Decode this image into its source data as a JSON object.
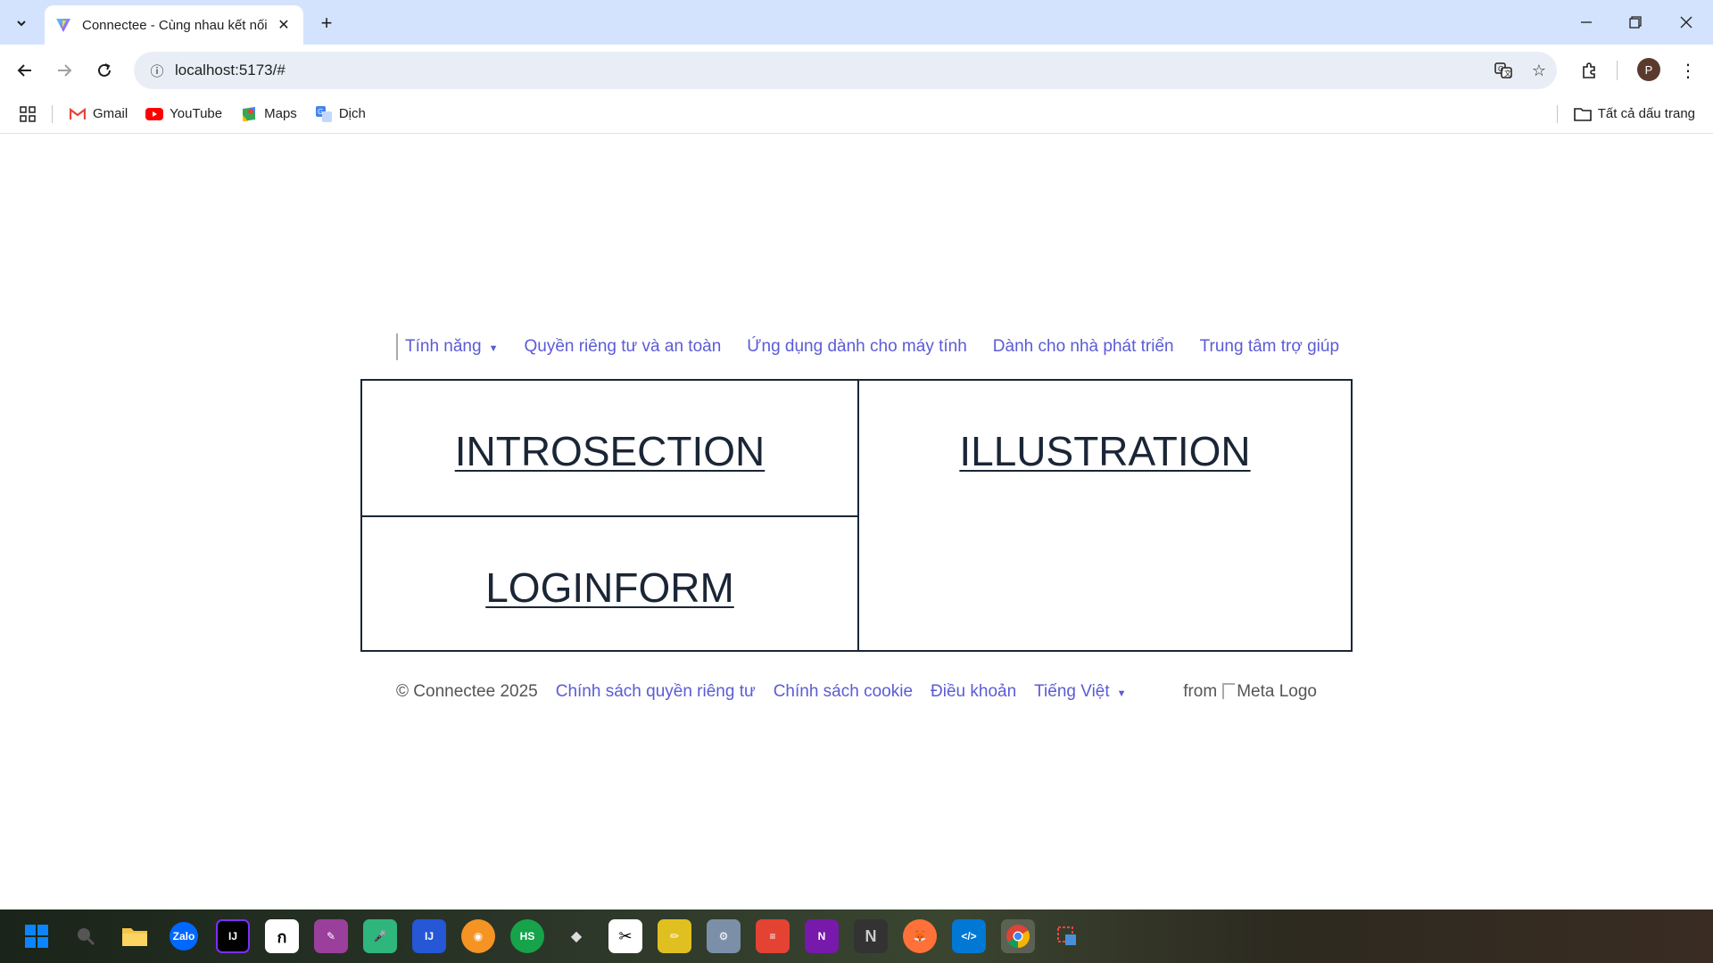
{
  "browser": {
    "tab_title": "Connectee - Cùng nhau kết nối",
    "url": "localhost:5173/#",
    "bookmarks": [
      {
        "label": "Gmail",
        "icon": "gmail-icon"
      },
      {
        "label": "YouTube",
        "icon": "youtube-icon"
      },
      {
        "label": "Maps",
        "icon": "maps-icon"
      },
      {
        "label": "Dịch",
        "icon": "translate-icon"
      }
    ],
    "all_bookmarks": "Tất cả dấu trang",
    "profile_initial": "P"
  },
  "nav": {
    "features": "Tính năng",
    "privacy": "Quyền riêng tư và an toàn",
    "desktop_app": "Ứng dụng dành cho máy tính",
    "developers": "Dành cho nhà phát triển",
    "help_center": "Trung tâm trợ giúp"
  },
  "main": {
    "intro": "INTROSECTION",
    "illustration": "ILLUSTRATION",
    "login": "LOGINFORM"
  },
  "footer": {
    "copyright": "© Connectee 2025",
    "privacy_policy": "Chính sách quyền riêng tư",
    "cookie_policy": "Chính sách cookie",
    "terms": "Điều khoản",
    "language": "Tiếng Việt",
    "from": "from",
    "meta_logo_alt": "Meta Logo"
  },
  "taskbar": {
    "apps": [
      "start",
      "search",
      "file-explorer",
      "zalo",
      "intellij",
      "notion-alt",
      "figma-alt",
      "mic-app",
      "jetbrains",
      "brave",
      "hs-app",
      "box-app",
      "capcut",
      "pencil-app",
      "toolbox",
      "todoist",
      "onenote",
      "notion",
      "firefox",
      "vscode",
      "chrome",
      "snipping"
    ]
  }
}
